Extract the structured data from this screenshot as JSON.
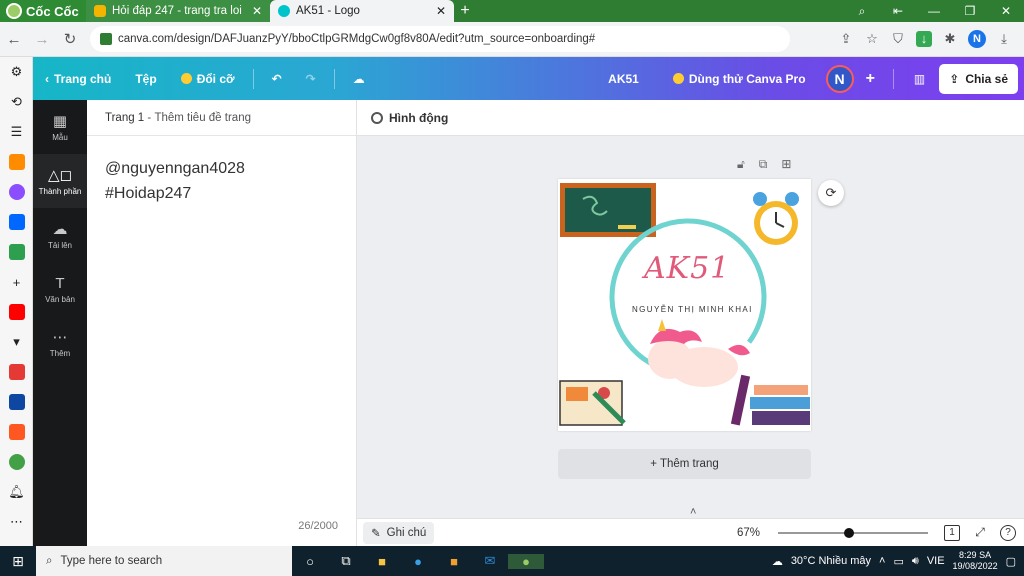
{
  "browser": {
    "brand": "Cốc Cốc",
    "tabs": [
      {
        "title": "Hỏi đáp 247 - trang tra loi",
        "active": false
      },
      {
        "title": "AK51 - Logo",
        "active": true
      }
    ],
    "url": "canva.com/design/DAFJuanzPyY/bboCtlpGRMdgCw0gf8v80A/edit?utm_source=onboarding#",
    "profile_initial": "N"
  },
  "canva": {
    "topbar": {
      "home": "Trang chủ",
      "file": "Tệp",
      "resize": "Đổi cỡ",
      "design_title": "AK51",
      "pro": "Dùng thử Canva Pro",
      "avatar": "N",
      "share": "Chia sẻ"
    },
    "rail": [
      {
        "label": "Mẫu",
        "icon": "template-icon"
      },
      {
        "label": "Thành phần",
        "icon": "elements-icon"
      },
      {
        "label": "Tải lên",
        "icon": "upload-icon"
      },
      {
        "label": "Văn bản",
        "icon": "text-icon"
      },
      {
        "label": "Thêm",
        "icon": "more-icon"
      }
    ],
    "notes": {
      "page_label": "Trang 1",
      "page_title_placeholder": "Thêm tiêu đề trang",
      "line1": "@nguyenngan4028",
      "line2": "#Hoidap247",
      "count": "26/2000"
    },
    "animation": "Hình động",
    "logo": {
      "title": "AK51",
      "subtitle": "NGUYỄN THỊ MINH KHAI"
    },
    "add_page": "+ Thêm trang",
    "bottom": {
      "notes": "Ghi chú",
      "zoom": "67%",
      "zoom_level": 0.47,
      "pages": "1"
    }
  },
  "taskbar": {
    "search_placeholder": "Type here to search",
    "weather": "30°C  Nhiều mây",
    "lang": "VIE",
    "time": "8:29 SA",
    "date": "19/08/2022"
  },
  "colors": {
    "canva_gradient_start": "#16b6c7",
    "canva_gradient_end": "#7d3ef0",
    "logo_title": "#e05a7a",
    "logo_ring": "#6fd3cf"
  }
}
